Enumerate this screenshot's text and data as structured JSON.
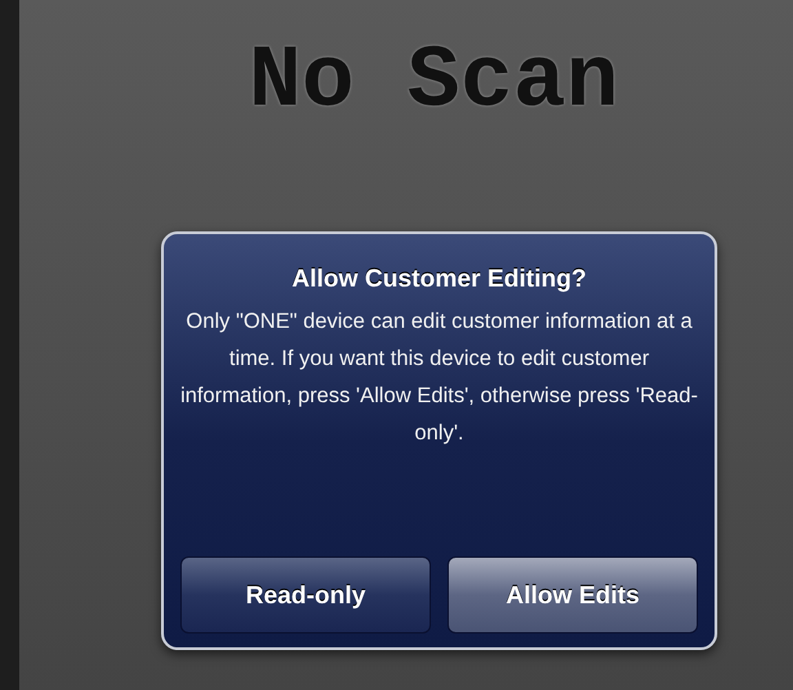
{
  "screen_title": "No Scan",
  "alert": {
    "title": "Allow Customer Editing?",
    "message": "Only \"ONE\" device can edit customer information at a time.  If you want this device to edit customer information, press 'Allow Edits', otherwise press 'Read-only'.",
    "buttons": [
      {
        "label": "Read-only",
        "default": false
      },
      {
        "label": "Allow Edits",
        "default": true
      }
    ]
  }
}
